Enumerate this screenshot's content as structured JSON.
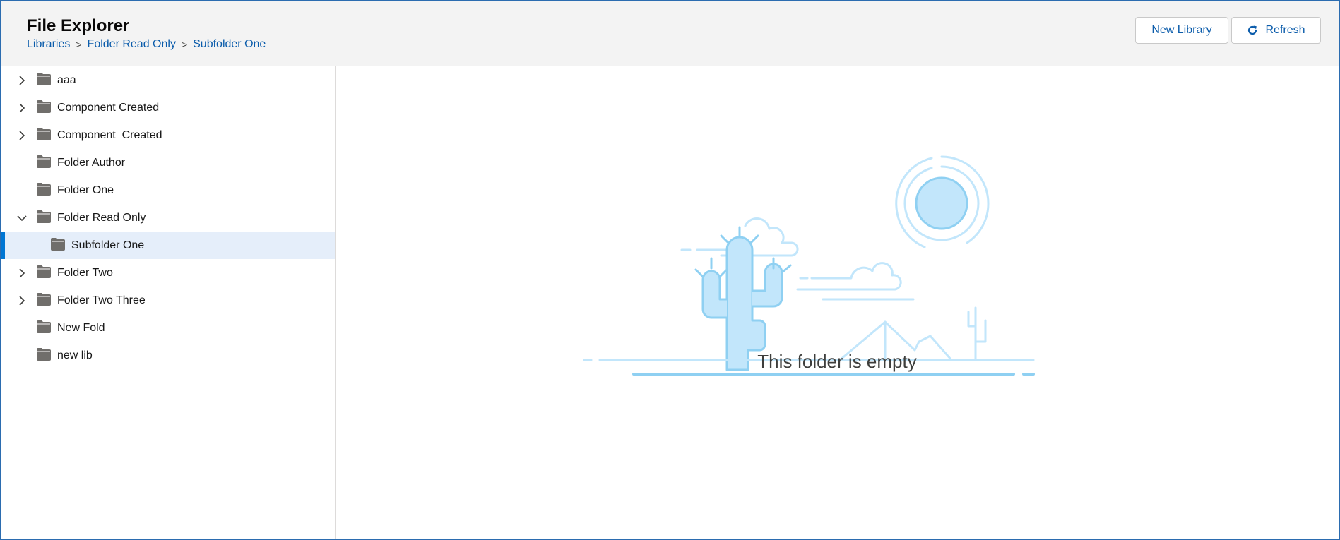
{
  "header": {
    "title": "File Explorer",
    "breadcrumb": [
      "Libraries",
      "Folder Read Only",
      "Subfolder One"
    ],
    "breadcrumb_separator": ">",
    "new_library_label": "New Library",
    "refresh_label": "Refresh"
  },
  "tree": {
    "items": [
      {
        "label": "aaa",
        "expandable": true,
        "expanded": false,
        "depth": 0
      },
      {
        "label": "Component Created",
        "expandable": true,
        "expanded": false,
        "depth": 0
      },
      {
        "label": "Component_Created",
        "expandable": true,
        "expanded": false,
        "depth": 0
      },
      {
        "label": "Folder Author",
        "expandable": false,
        "depth": 0
      },
      {
        "label": "Folder One",
        "expandable": false,
        "depth": 0
      },
      {
        "label": "Folder Read Only",
        "expandable": true,
        "expanded": true,
        "depth": 0
      },
      {
        "label": "Subfolder One",
        "expandable": false,
        "depth": 1,
        "selected": true
      },
      {
        "label": "Folder Two",
        "expandable": true,
        "expanded": false,
        "depth": 0
      },
      {
        "label": "Folder Two Three",
        "expandable": true,
        "expanded": false,
        "depth": 0
      },
      {
        "label": "New Fold",
        "expandable": false,
        "depth": 0
      },
      {
        "label": "new lib",
        "expandable": false,
        "depth": 0
      }
    ]
  },
  "main": {
    "empty_message": "This folder is empty"
  },
  "colors": {
    "accent": "#0176d3",
    "link": "#0b5cab",
    "selected_bg": "#e5eefa",
    "illustration_light": "#c2e6fb",
    "illustration_stroke": "#8fd0f2"
  }
}
